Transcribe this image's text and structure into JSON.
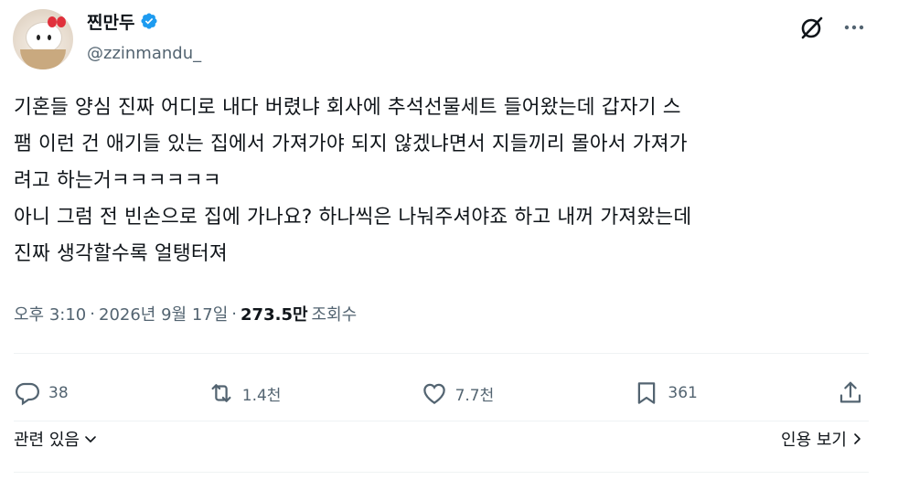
{
  "author": {
    "name": "찐만두",
    "handle": "@zzinmandu_",
    "verified": true
  },
  "tweet": {
    "lines": [
      "기혼들 양심 진짜 어디로 내다 버렸냐 회사에 추석선물세트 들어왔는데 갑자기 스",
      "팸 이런 건 애기들 있는 집에서 가져가야 되지 않겠냐면서 지들끼리 몰아서 가져가",
      "려고 하는거ㅋㅋㅋㅋㅋㅋ",
      "아니 그럼 전 빈손으로 집에 가나요? 하나씩은 나눠주셔야죠 하고 내꺼 가져왔는데",
      "진짜 생각할수록 얼탱터져"
    ]
  },
  "meta": {
    "time": "오후 3:10",
    "sep1": "·",
    "date": "2026년 9월 17일",
    "sep2": "·",
    "views": "273.5만",
    "views_label": "조회수"
  },
  "actions": {
    "replies": "38",
    "reposts": "1.4천",
    "likes": "7.7천",
    "bookmarks": "361"
  },
  "footer": {
    "related": "관련 있음",
    "quotes": "인용 보기"
  },
  "icons": [
    "grok-icon",
    "more-icon",
    "reply-icon",
    "repost-icon",
    "like-icon",
    "bookmark-icon",
    "share-icon",
    "verified-badge-icon"
  ],
  "colors": {
    "verified": "#1d9bf0",
    "muted": "#536471",
    "text": "#0f1419"
  }
}
